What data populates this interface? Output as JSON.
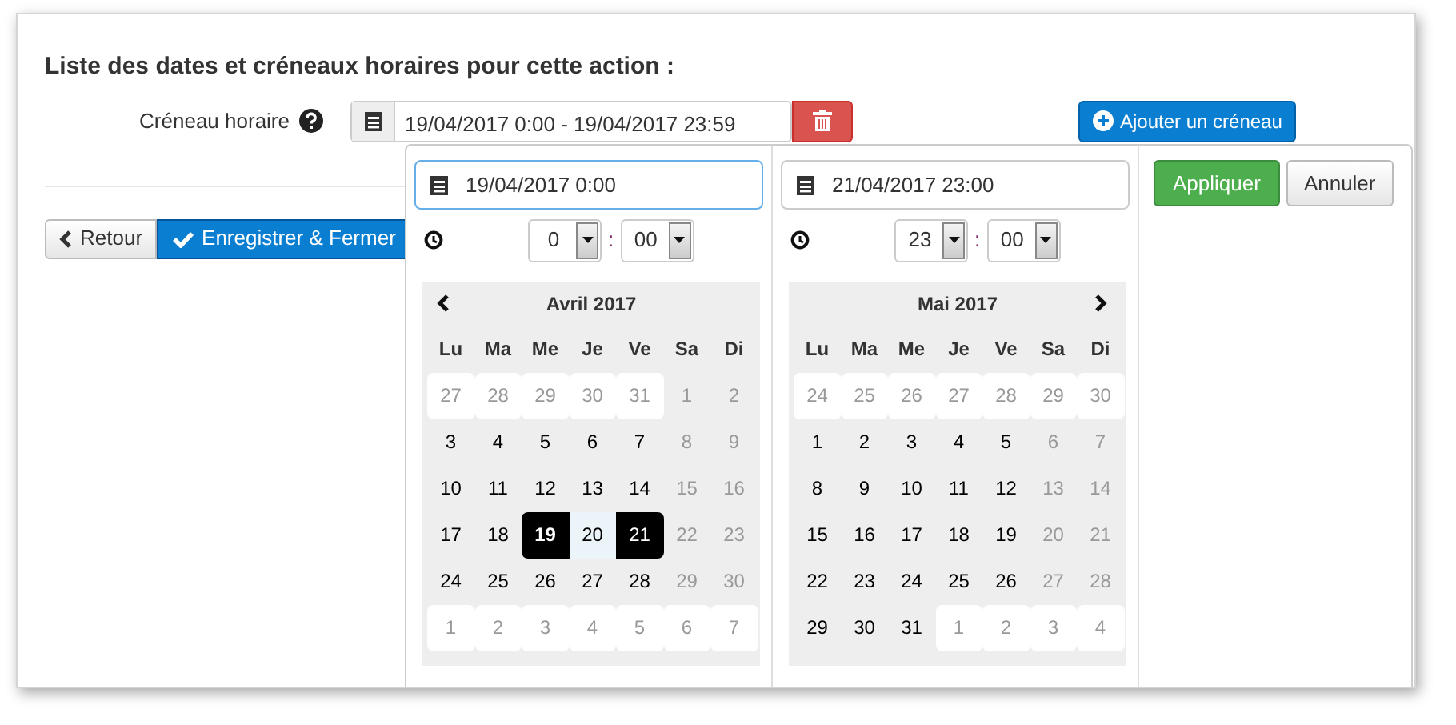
{
  "heading": "Liste des dates et créneaux horaires pour cette action :",
  "slot": {
    "label": "Créneau horaire",
    "value": "19/04/2017 0:00 - 19/04/2017 23:59"
  },
  "add_button": "Ajouter un créneau",
  "back_button": "Retour",
  "save_button": "Enregistrer & Fermer",
  "picker": {
    "apply": "Appliquer",
    "cancel": "Annuler",
    "calendars": [
      {
        "date": "19/04/2017 0:00",
        "focused": true,
        "hour": "0",
        "separator": ":",
        "minute": "00",
        "month": "Avril 2017",
        "prev_button": true,
        "next_button": false,
        "weekdays": [
          "Lu",
          "Ma",
          "Me",
          "Je",
          "Ve",
          "Sa",
          "Di"
        ],
        "weeks": [
          [
            {
              "d": "27",
              "kind": "off"
            },
            {
              "d": "28",
              "kind": "off"
            },
            {
              "d": "29",
              "kind": "off"
            },
            {
              "d": "30",
              "kind": "off"
            },
            {
              "d": "31",
              "kind": "off"
            },
            {
              "d": "1",
              "kind": "weekend"
            },
            {
              "d": "2",
              "kind": "weekend"
            }
          ],
          [
            {
              "d": "3",
              "kind": "normal"
            },
            {
              "d": "4",
              "kind": "normal"
            },
            {
              "d": "5",
              "kind": "normal"
            },
            {
              "d": "6",
              "kind": "normal"
            },
            {
              "d": "7",
              "kind": "normal"
            },
            {
              "d": "8",
              "kind": "weekend"
            },
            {
              "d": "9",
              "kind": "weekend"
            }
          ],
          [
            {
              "d": "10",
              "kind": "normal"
            },
            {
              "d": "11",
              "kind": "normal"
            },
            {
              "d": "12",
              "kind": "normal"
            },
            {
              "d": "13",
              "kind": "normal"
            },
            {
              "d": "14",
              "kind": "normal"
            },
            {
              "d": "15",
              "kind": "weekend"
            },
            {
              "d": "16",
              "kind": "weekend"
            }
          ],
          [
            {
              "d": "17",
              "kind": "normal"
            },
            {
              "d": "18",
              "kind": "normal"
            },
            {
              "d": "19",
              "kind": "start"
            },
            {
              "d": "20",
              "kind": "range"
            },
            {
              "d": "21",
              "kind": "end"
            },
            {
              "d": "22",
              "kind": "weekend"
            },
            {
              "d": "23",
              "kind": "weekend"
            }
          ],
          [
            {
              "d": "24",
              "kind": "normal"
            },
            {
              "d": "25",
              "kind": "normal"
            },
            {
              "d": "26",
              "kind": "normal"
            },
            {
              "d": "27",
              "kind": "normal"
            },
            {
              "d": "28",
              "kind": "normal"
            },
            {
              "d": "29",
              "kind": "weekend"
            },
            {
              "d": "30",
              "kind": "weekend"
            }
          ],
          [
            {
              "d": "1",
              "kind": "off"
            },
            {
              "d": "2",
              "kind": "off"
            },
            {
              "d": "3",
              "kind": "off"
            },
            {
              "d": "4",
              "kind": "off"
            },
            {
              "d": "5",
              "kind": "off"
            },
            {
              "d": "6",
              "kind": "off"
            },
            {
              "d": "7",
              "kind": "off"
            }
          ]
        ]
      },
      {
        "date": "21/04/2017 23:00",
        "focused": false,
        "hour": "23",
        "separator": ":",
        "minute": "00",
        "month": "Mai 2017",
        "prev_button": false,
        "next_button": true,
        "weekdays": [
          "Lu",
          "Ma",
          "Me",
          "Je",
          "Ve",
          "Sa",
          "Di"
        ],
        "weeks": [
          [
            {
              "d": "24",
              "kind": "off"
            },
            {
              "d": "25",
              "kind": "off"
            },
            {
              "d": "26",
              "kind": "off"
            },
            {
              "d": "27",
              "kind": "off"
            },
            {
              "d": "28",
              "kind": "off"
            },
            {
              "d": "29",
              "kind": "off"
            },
            {
              "d": "30",
              "kind": "off"
            }
          ],
          [
            {
              "d": "1",
              "kind": "normal"
            },
            {
              "d": "2",
              "kind": "normal"
            },
            {
              "d": "3",
              "kind": "normal"
            },
            {
              "d": "4",
              "kind": "normal"
            },
            {
              "d": "5",
              "kind": "normal"
            },
            {
              "d": "6",
              "kind": "weekend"
            },
            {
              "d": "7",
              "kind": "weekend"
            }
          ],
          [
            {
              "d": "8",
              "kind": "normal"
            },
            {
              "d": "9",
              "kind": "normal"
            },
            {
              "d": "10",
              "kind": "normal"
            },
            {
              "d": "11",
              "kind": "normal"
            },
            {
              "d": "12",
              "kind": "normal"
            },
            {
              "d": "13",
              "kind": "weekend"
            },
            {
              "d": "14",
              "kind": "weekend"
            }
          ],
          [
            {
              "d": "15",
              "kind": "normal"
            },
            {
              "d": "16",
              "kind": "normal"
            },
            {
              "d": "17",
              "kind": "normal"
            },
            {
              "d": "18",
              "kind": "normal"
            },
            {
              "d": "19",
              "kind": "normal"
            },
            {
              "d": "20",
              "kind": "weekend"
            },
            {
              "d": "21",
              "kind": "weekend"
            }
          ],
          [
            {
              "d": "22",
              "kind": "normal"
            },
            {
              "d": "23",
              "kind": "normal"
            },
            {
              "d": "24",
              "kind": "normal"
            },
            {
              "d": "25",
              "kind": "normal"
            },
            {
              "d": "26",
              "kind": "normal"
            },
            {
              "d": "27",
              "kind": "weekend"
            },
            {
              "d": "28",
              "kind": "weekend"
            }
          ],
          [
            {
              "d": "29",
              "kind": "normal"
            },
            {
              "d": "30",
              "kind": "normal"
            },
            {
              "d": "31",
              "kind": "normal"
            },
            {
              "d": "1",
              "kind": "off"
            },
            {
              "d": "2",
              "kind": "off"
            },
            {
              "d": "3",
              "kind": "off"
            },
            {
              "d": "4",
              "kind": "off"
            }
          ]
        ]
      }
    ]
  }
}
